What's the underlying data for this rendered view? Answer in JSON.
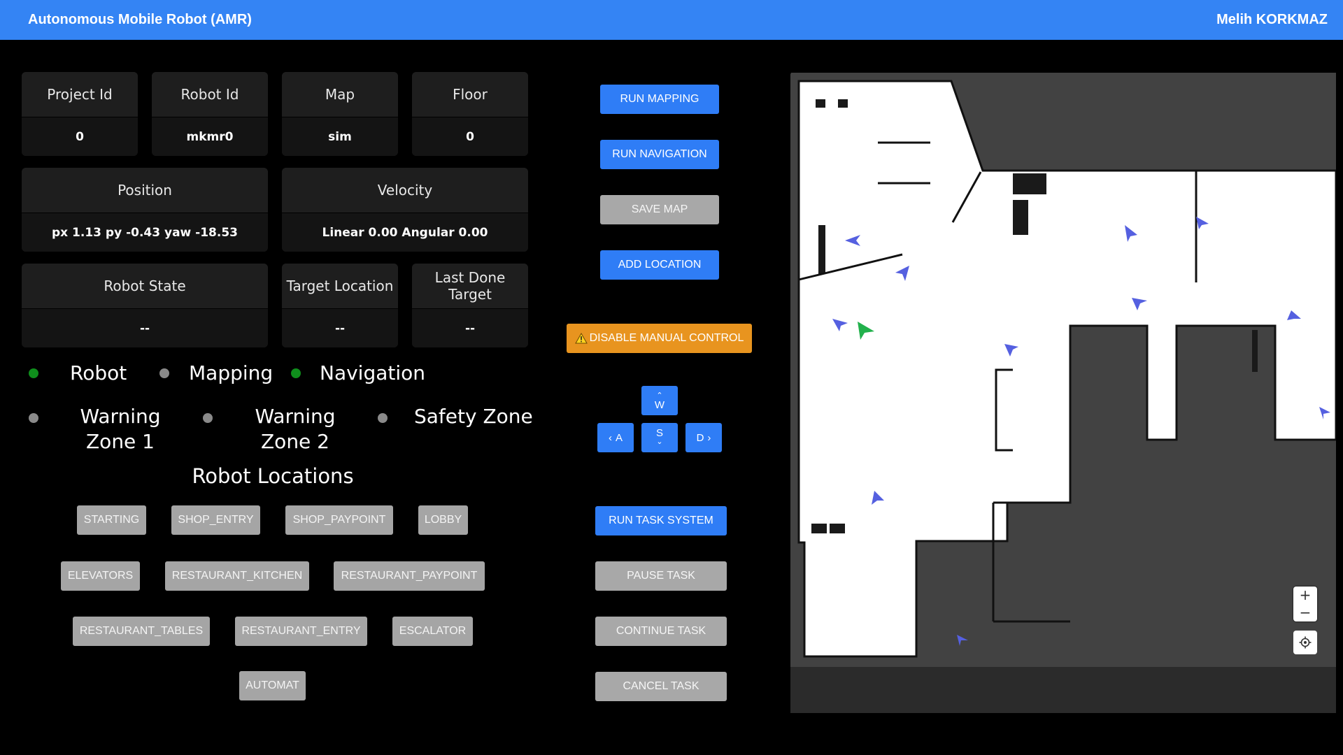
{
  "header": {
    "title": "Autonomous Mobile Robot (AMR)",
    "user": "Melih KORKMAZ"
  },
  "info": {
    "project_id": {
      "label": "Project Id",
      "value": "0"
    },
    "robot_id": {
      "label": "Robot Id",
      "value": "mkmr0"
    },
    "map": {
      "label": "Map",
      "value": "sim"
    },
    "floor": {
      "label": "Floor",
      "value": "0"
    },
    "position": {
      "label": "Position",
      "value": "px 1.13 py -0.43 yaw -18.53"
    },
    "velocity": {
      "label": "Velocity",
      "value": "Linear 0.00 Angular 0.00"
    },
    "robot_state": {
      "label": "Robot State",
      "value": "--"
    },
    "target_location": {
      "label": "Target Location",
      "value": "--"
    },
    "last_done_target": {
      "label": "Last Done Target",
      "value": "--"
    }
  },
  "status": {
    "robot": {
      "label": "Robot",
      "color": "#0f8f1c"
    },
    "mapping": {
      "label": "Mapping",
      "color": "#8a8a8a"
    },
    "navigation": {
      "label": "Navigation",
      "color": "#0f8f1c"
    },
    "warning_zone_1": {
      "label1": "Warning",
      "label2": "Zone 1",
      "color": "#8a8a8a"
    },
    "warning_zone_2": {
      "label1": "Warning",
      "label2": "Zone 2",
      "color": "#8a8a8a"
    },
    "safety_zone": {
      "label": "Safety Zone",
      "color": "#8a8a8a"
    }
  },
  "locations_title": "Robot Locations",
  "locations": [
    "STARTING",
    "SHOP_ENTRY",
    "SHOP_PAYPOINT",
    "LOBBY",
    "ELEVATORS",
    "RESTAURANT_KITCHEN",
    "RESTAURANT_PAYPOINT",
    "RESTAURANT_TABLES",
    "RESTAURANT_ENTRY",
    "ESCALATOR",
    "AUTOMAT"
  ],
  "controls": {
    "run_mapping": "RUN MAPPING",
    "run_navigation": "RUN NAVIGATION",
    "save_map": "SAVE MAP",
    "add_location": "ADD LOCATION",
    "disable_manual": "DISABLE MANUAL CONTROL",
    "key_w": "W",
    "key_a": "A",
    "key_s": "S",
    "key_d": "D",
    "run_task": "RUN TASK SYSTEM",
    "pause_task": "PAUSE TASK",
    "continue_task": "CONTINUE TASK",
    "cancel_task": "CANCEL TASK"
  },
  "map": {
    "zoom_in": "+",
    "zoom_out": "−",
    "free_color": "#ffffff",
    "unknown_color": "#424242",
    "marker_color": "#5560e0",
    "robot_color": "#22b14c"
  }
}
